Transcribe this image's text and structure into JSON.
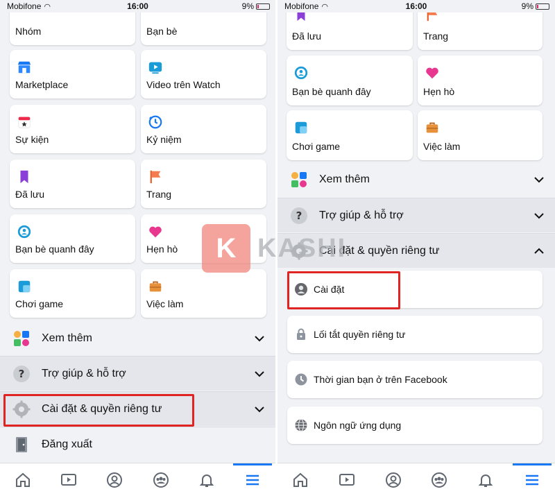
{
  "status_bar": {
    "carrier": "Mobifone",
    "time": "16:00",
    "battery": "9%"
  },
  "left": {
    "tiles": [
      {
        "label": "Nhóm",
        "icon": "groups-icon"
      },
      {
        "label": "Bạn bè",
        "icon": "friends-icon"
      },
      {
        "label": "Marketplace",
        "icon": "marketplace-icon"
      },
      {
        "label": "Video trên Watch",
        "icon": "watch-icon"
      },
      {
        "label": "Sự kiện",
        "icon": "events-icon"
      },
      {
        "label": "Kỷ niệm",
        "icon": "memories-icon"
      },
      {
        "label": "Đã lưu",
        "icon": "saved-icon"
      },
      {
        "label": "Trang",
        "icon": "pages-icon"
      },
      {
        "label": "Bạn bè quanh đây",
        "icon": "nearby-friends-icon"
      },
      {
        "label": "Hẹn hò",
        "icon": "dating-icon"
      },
      {
        "label": "Chơi game",
        "icon": "gaming-icon"
      },
      {
        "label": "Việc làm",
        "icon": "jobs-icon"
      }
    ],
    "see_more": "Xem thêm",
    "help": "Trợ giúp & hỗ trợ",
    "settings_privacy": "Cài đặt & quyền riêng tư",
    "logout": "Đăng xuất"
  },
  "right": {
    "tiles": [
      {
        "label": "Đã lưu",
        "icon": "saved-icon"
      },
      {
        "label": "Trang",
        "icon": "pages-icon"
      },
      {
        "label": "Bạn bè quanh đây",
        "icon": "nearby-friends-icon"
      },
      {
        "label": "Hẹn hò",
        "icon": "dating-icon"
      },
      {
        "label": "Chơi game",
        "icon": "gaming-icon"
      },
      {
        "label": "Việc làm",
        "icon": "jobs-icon"
      }
    ],
    "see_more": "Xem thêm",
    "help": "Trợ giúp & hỗ trợ",
    "settings_privacy": "Cài đặt & quyền riêng tư",
    "sub_items": [
      {
        "label": "Cài đặt",
        "icon": "account-icon"
      },
      {
        "label": "Lối tắt quyền riêng tư",
        "icon": "lock-icon"
      },
      {
        "label": "Thời gian bạn ở trên Facebook",
        "icon": "clock-icon"
      },
      {
        "label": "Ngôn ngữ ứng dụng",
        "icon": "globe-icon"
      }
    ]
  },
  "watermark": {
    "letter": "K",
    "text": "KASHI"
  },
  "colors": {
    "accent": "#1877f2",
    "highlight": "#e02424",
    "background": "#f0f2f5"
  }
}
